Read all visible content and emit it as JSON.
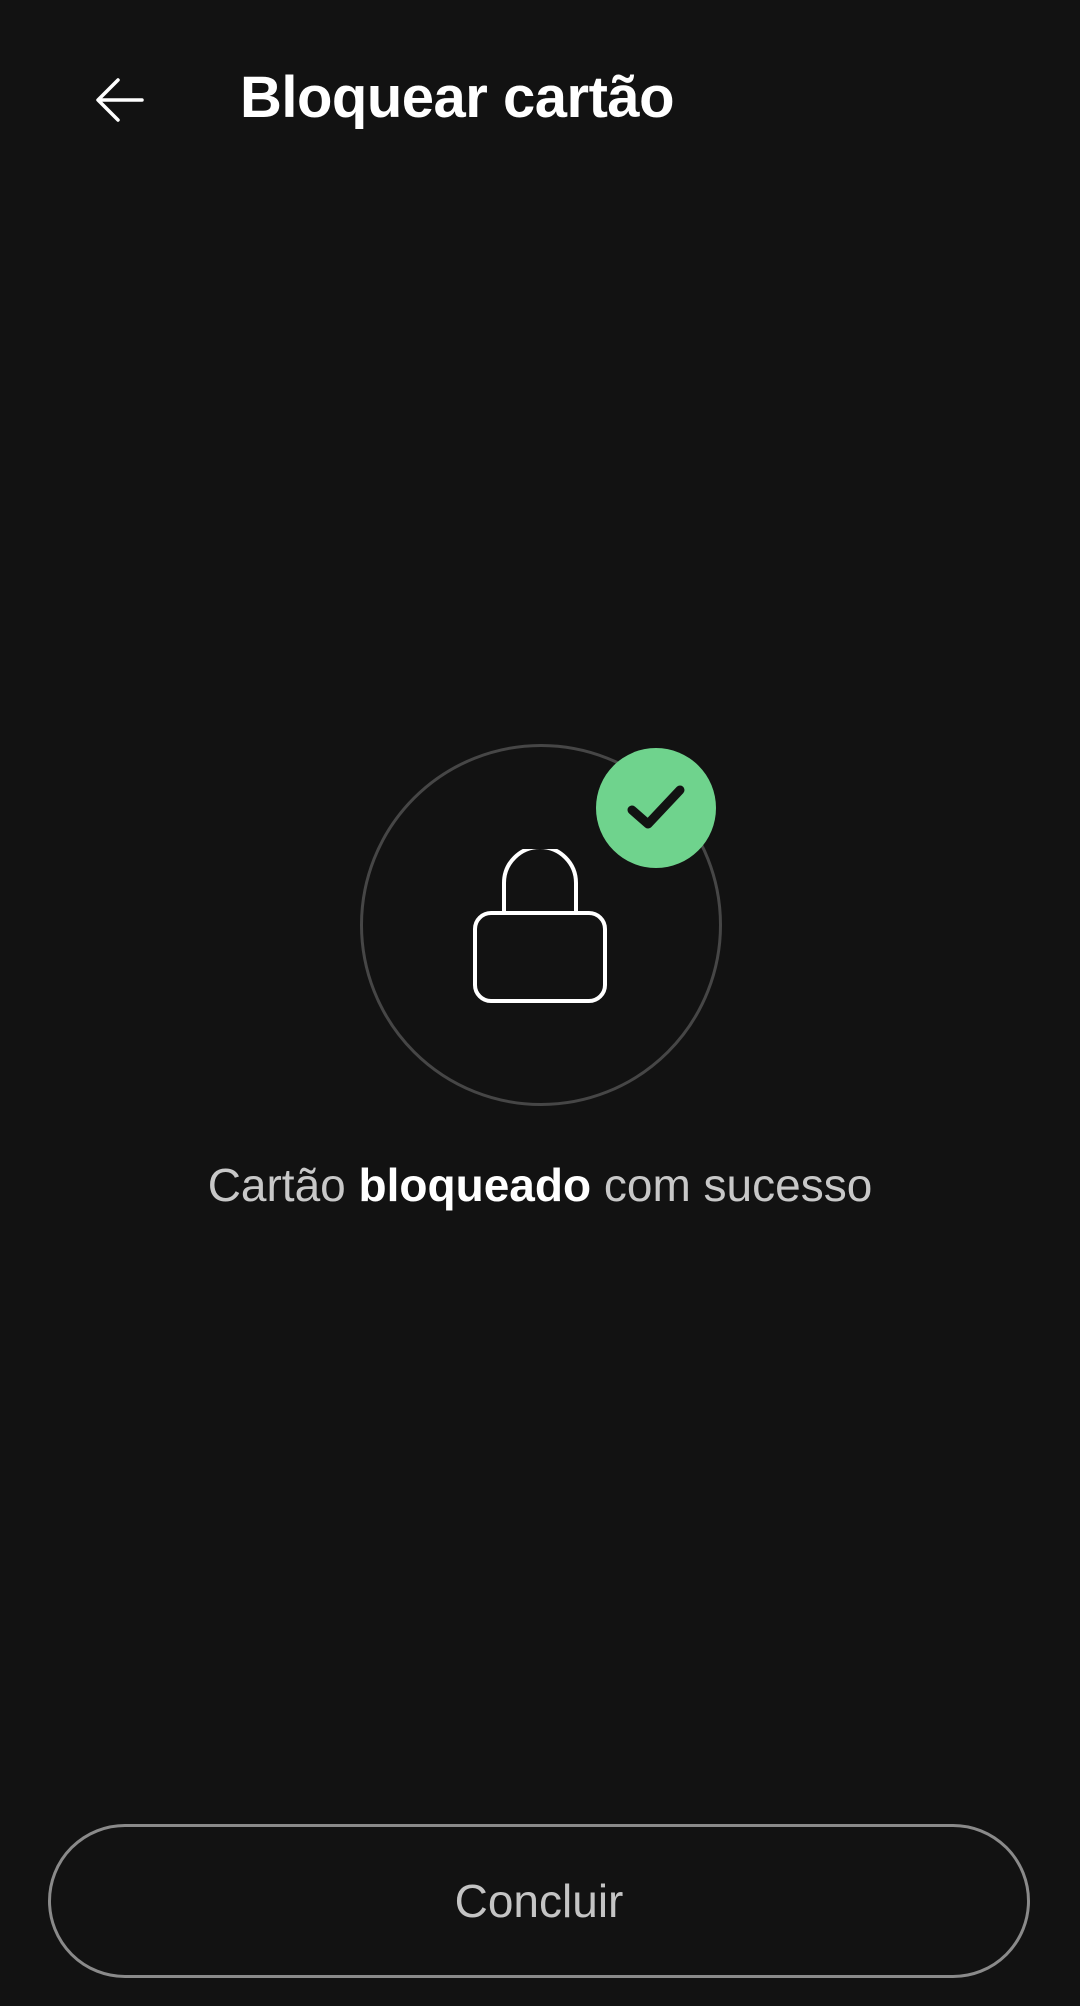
{
  "header": {
    "title": "Bloquear cartão",
    "back_icon": "arrow-left-icon"
  },
  "status": {
    "icon": "lock-icon",
    "badge_icon": "check-icon",
    "badge_color": "#6fd38d",
    "message_prefix": "Cartão",
    "message_emphasis": "bloqueado",
    "message_suffix": "com sucesso"
  },
  "footer": {
    "done_label": "Concluir"
  }
}
